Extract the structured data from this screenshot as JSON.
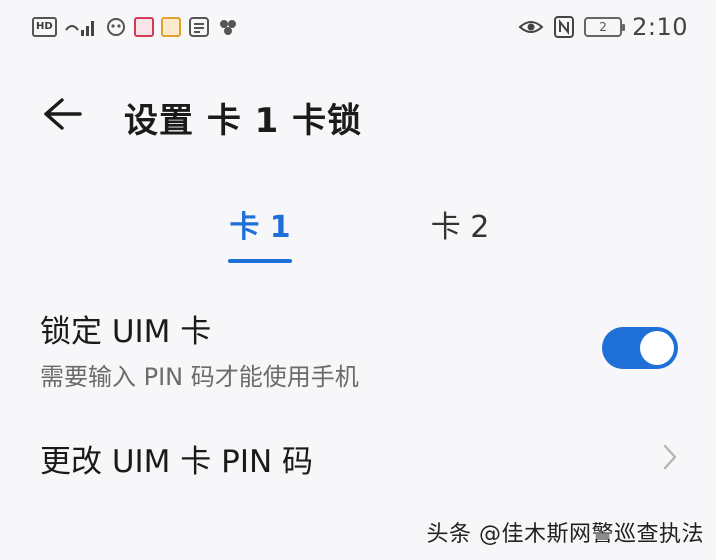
{
  "status_bar": {
    "time": "2:10",
    "left_icons": [
      "hd-icon",
      "wifi-signal-icon",
      "app-notification-icon",
      "app-notification-icon",
      "app-notification-icon",
      "app-notification-icon",
      "app-notification-icon"
    ],
    "hd_label": "HD",
    "battery_label": "2"
  },
  "header": {
    "title": "设置 卡 1 卡锁"
  },
  "tabs": [
    {
      "label": "卡 1",
      "active": true
    },
    {
      "label": "卡 2",
      "active": false
    }
  ],
  "settings": {
    "lock_uim": {
      "title": "锁定 UIM 卡",
      "subtitle": "需要输入 PIN 码才能使用手机",
      "enabled": true
    },
    "change_pin": {
      "title": "更改 UIM 卡 PIN 码"
    }
  },
  "watermark": "头条 @佳木斯网警巡查执法",
  "colors": {
    "accent": "#1f6fd9",
    "background": "#f7f7f9"
  }
}
